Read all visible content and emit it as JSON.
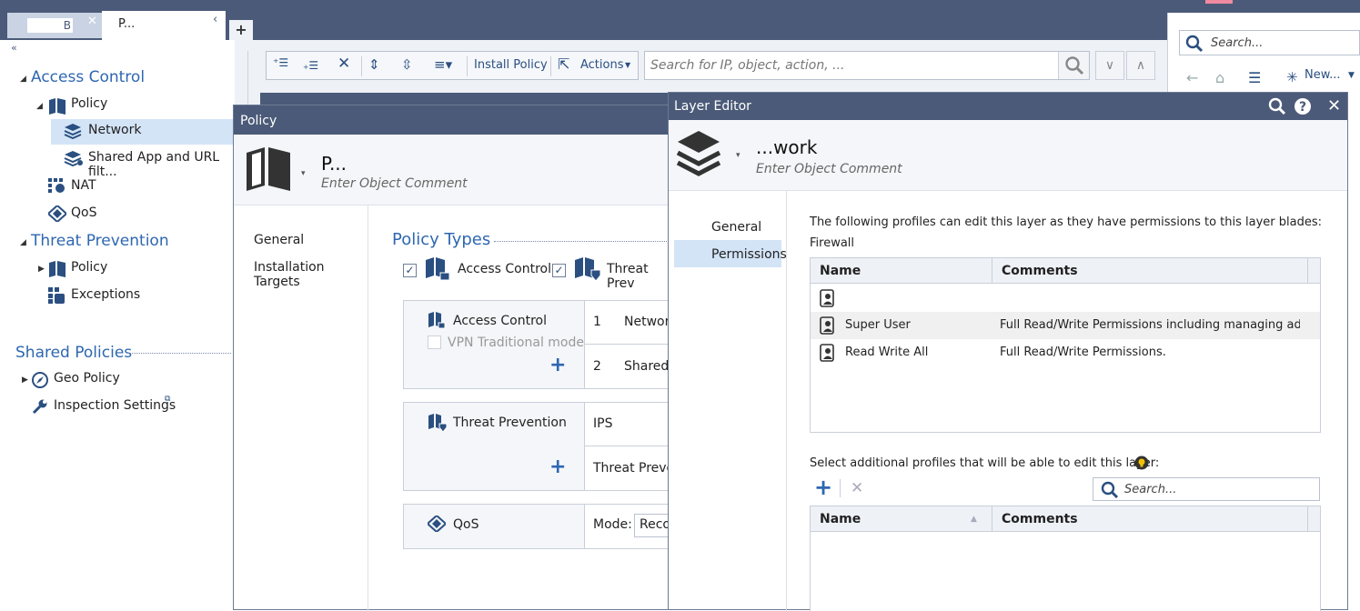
{
  "tabs": [
    {
      "label": "B"
    },
    {
      "label": "P..."
    }
  ],
  "tab_add_label": "+",
  "nav": {
    "collapse": "«",
    "access_control": "Access Control",
    "ac_policy": "Policy",
    "ac_network": "Network",
    "ac_shared": "Shared App and URL filt...",
    "nat": "NAT",
    "qos": "QoS",
    "threat_prevention": "Threat Prevention",
    "tp_policy": "Policy",
    "tp_exceptions": "Exceptions",
    "shared_policies": "Shared Policies",
    "geo_policy": "Geo Policy",
    "inspection_settings": "Inspection Settings"
  },
  "toolbar": {
    "install_policy": "Install Policy",
    "actions": "Actions",
    "search_placeholder": "Search for IP, object, action, ..."
  },
  "right_panel": {
    "search_placeholder": "Search...",
    "new_label": "New..."
  },
  "policy_dialog": {
    "title": "Policy",
    "name": "P...",
    "comment_placeholder": "Enter Object Comment",
    "nav": [
      "General",
      "Installation Targets"
    ],
    "policy_types_title": "Policy Types",
    "type_access_control": "Access Control",
    "type_threat_prevention": "Threat Prev",
    "ac_box_label": "Access Control",
    "vpn_traditional": "VPN Traditional mode",
    "ac_layers": [
      {
        "num": "1",
        "name": "Network"
      },
      {
        "num": "2",
        "name": "Shared"
      }
    ],
    "tp_box_label": "Threat Prevention",
    "tp_layers": [
      "IPS",
      "Threat Preven"
    ],
    "qos_box_label": "QoS",
    "qos_mode_label": "Mode:",
    "qos_mode_value": "Reco"
  },
  "layer_editor": {
    "title": "Layer Editor",
    "name": "...work",
    "comment_placeholder": "Enter Object Comment",
    "nav": [
      "General",
      "Permissions"
    ],
    "permissions_intro": "The following profiles can edit this layer as they have permissions to this layer blades:",
    "blade": "Firewall",
    "col_name": "Name",
    "col_comments": "Comments",
    "profiles": [
      {
        "name": "",
        "comment": ""
      },
      {
        "name": "Super User",
        "comment": "Full Read/Write Permissions including managing ad..."
      },
      {
        "name": "Read Write All",
        "comment": "Full Read/Write Permissions."
      }
    ],
    "select_additional": "Select additional profiles that will be able to edit this layer:",
    "search_placeholder": "Search..."
  },
  "colors": {
    "titlebar": "#4b5a78",
    "accent": "#2e67b0",
    "selection": "#d3e4f7"
  }
}
